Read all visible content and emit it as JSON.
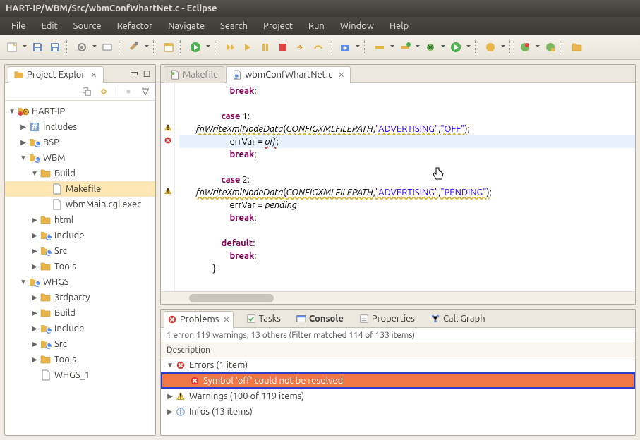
{
  "title": "HART-IP/WBM/Src/wbmConfWhartNet.c - Eclipse",
  "menu": [
    "File",
    "Edit",
    "Source",
    "Refactor",
    "Navigate",
    "Search",
    "Project",
    "Run",
    "Window",
    "Help"
  ],
  "explorer": {
    "title": "Project Explor",
    "tree": [
      {
        "depth": 0,
        "tw": "▼",
        "icon": "proj",
        "label": "HART-IP"
      },
      {
        "depth": 1,
        "tw": "▶",
        "icon": "inc",
        "label": "Includes"
      },
      {
        "depth": 1,
        "tw": "▶",
        "icon": "cfolder",
        "label": "BSP"
      },
      {
        "depth": 1,
        "tw": "▼",
        "icon": "cfolder",
        "label": "WBM"
      },
      {
        "depth": 2,
        "tw": "▼",
        "icon": "folder",
        "label": "Build"
      },
      {
        "depth": 3,
        "tw": "",
        "icon": "file",
        "label": "Makefile",
        "sel": true
      },
      {
        "depth": 3,
        "tw": "",
        "icon": "file",
        "label": "wbmMain.cgi.exec"
      },
      {
        "depth": 2,
        "tw": "▶",
        "icon": "folder",
        "label": "html"
      },
      {
        "depth": 2,
        "tw": "▶",
        "icon": "cfolder",
        "label": "Include"
      },
      {
        "depth": 2,
        "tw": "▶",
        "icon": "cfolder",
        "label": "Src"
      },
      {
        "depth": 2,
        "tw": "▶",
        "icon": "folder",
        "label": "Tools"
      },
      {
        "depth": 1,
        "tw": "▼",
        "icon": "cfolder",
        "label": "WHGS"
      },
      {
        "depth": 2,
        "tw": "▶",
        "icon": "folder",
        "label": "3rdparty"
      },
      {
        "depth": 2,
        "tw": "▶",
        "icon": "folder",
        "label": "Build"
      },
      {
        "depth": 2,
        "tw": "▶",
        "icon": "cfolder",
        "label": "Include"
      },
      {
        "depth": 2,
        "tw": "▶",
        "icon": "cfolder",
        "label": "Src"
      },
      {
        "depth": 2,
        "tw": "▶",
        "icon": "folder",
        "label": "Tools"
      },
      {
        "depth": 2,
        "tw": "",
        "icon": "file",
        "label": "WHGS_1"
      }
    ]
  },
  "editor": {
    "tabs": [
      {
        "label": "Makefile",
        "icon": "mk",
        "active": false
      },
      {
        "label": "wbmConfWhartNet.c",
        "icon": "c",
        "active": true
      }
    ]
  },
  "problems": {
    "tabs": [
      {
        "label": "Problems",
        "icon": "err",
        "active": true,
        "closable": true
      },
      {
        "label": "Tasks",
        "icon": "task"
      },
      {
        "label": "Console",
        "icon": "console",
        "bold": true
      },
      {
        "label": "Properties",
        "icon": "prop"
      },
      {
        "label": "Call Graph",
        "icon": "graph"
      }
    ],
    "status": "1 error, 119 warnings, 13 others (Filter matched 114 of 133 items)",
    "header": "Description",
    "rows": [
      {
        "tw": "▼",
        "icon": "error",
        "label": "Errors (1 item)"
      },
      {
        "tw": "",
        "icon": "error-sm",
        "label": "Symbol 'off' could not be resolved",
        "sel": true,
        "indent": 1
      },
      {
        "tw": "▶",
        "icon": "warn",
        "label": "Warnings (100 of 119 items)"
      },
      {
        "tw": "▶",
        "icon": "info",
        "label": "Infos (13 items)"
      }
    ]
  }
}
